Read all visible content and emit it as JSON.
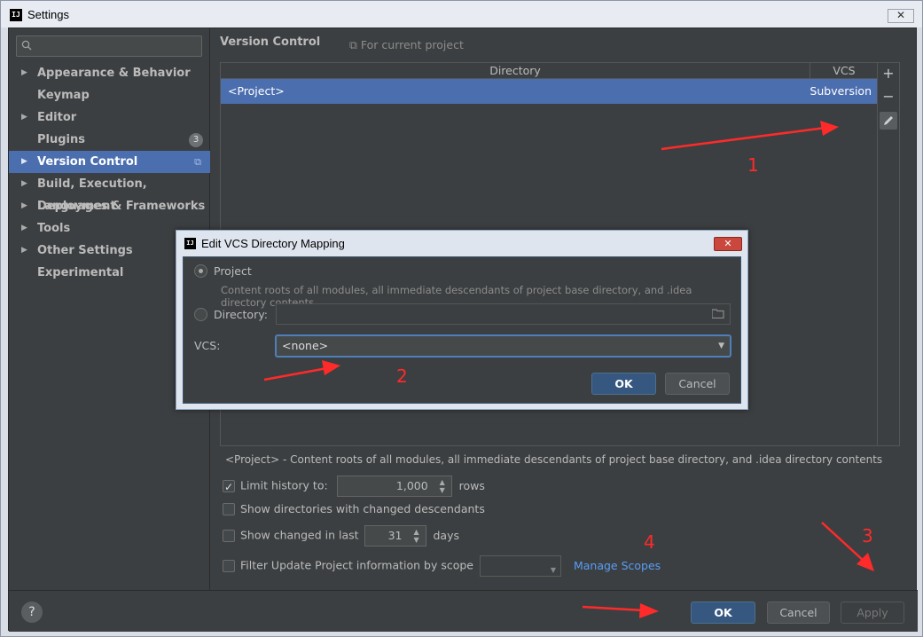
{
  "window": {
    "title": "Settings",
    "app_icon": "IJ",
    "close": "✕"
  },
  "sidebar": {
    "search": {
      "placeholder": ""
    },
    "items": [
      {
        "label": "Appearance & Behavior",
        "expandable": true
      },
      {
        "label": "Keymap",
        "expandable": false
      },
      {
        "label": "Editor",
        "expandable": true
      },
      {
        "label": "Plugins",
        "expandable": false,
        "badge": "3"
      },
      {
        "label": "Version Control",
        "expandable": true,
        "selected": true
      },
      {
        "label": "Build, Execution, Deployment",
        "expandable": true
      },
      {
        "label": "Languages & Frameworks",
        "expandable": true
      },
      {
        "label": "Tools",
        "expandable": true
      },
      {
        "label": "Other Settings",
        "expandable": true
      },
      {
        "label": "Experimental",
        "expandable": false
      }
    ]
  },
  "main": {
    "breadcrumb": "Version Control",
    "scope_hint": "For current project",
    "table": {
      "columns": [
        "Directory",
        "VCS"
      ],
      "rows": [
        {
          "directory": "<Project>",
          "vcs": "Subversion"
        }
      ]
    },
    "toolbar": {
      "add": "+",
      "remove": "−"
    },
    "description": "<Project> - Content roots of all modules, all immediate descendants of project base directory, and .idea directory contents",
    "options": {
      "limit_history_label": "Limit history to:",
      "limit_history_checked": true,
      "limit_history_value": "1,000",
      "limit_history_unit": "rows",
      "show_dirs_label": "Show directories with changed descendants",
      "show_changed_label": "Show changed in last",
      "show_changed_value": "31",
      "show_changed_unit": "days",
      "filter_label": "Filter Update Project information by scope",
      "manage_scopes": "Manage Scopes"
    }
  },
  "footer": {
    "help": "?",
    "ok": "OK",
    "cancel": "Cancel",
    "apply": "Apply"
  },
  "dialog": {
    "title": "Edit VCS Directory Mapping",
    "close": "✕",
    "project_label": "Project",
    "project_hint": "Content roots of all modules, all immediate descendants of project base directory, and .idea directory contents",
    "directory_label": "Directory:",
    "directory_value": "",
    "vcs_label": "VCS:",
    "vcs_value": "<none>",
    "ok": "OK",
    "cancel": "Cancel"
  },
  "annotations": {
    "n1": "1",
    "n2": "2",
    "n3": "3",
    "n4": "4",
    "color": "#ff2a2a"
  },
  "colors": {
    "selection": "#4b6eaf",
    "background": "#3c3f41",
    "link": "#589df6",
    "primary_button": "#365880"
  }
}
